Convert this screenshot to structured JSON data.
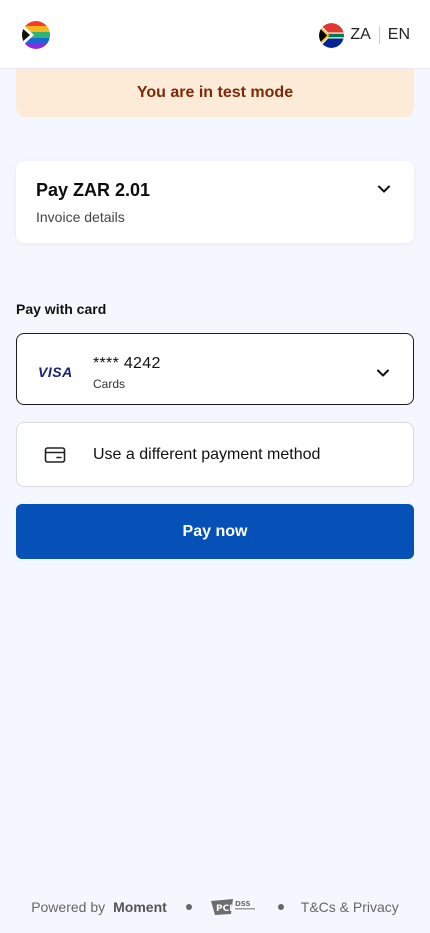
{
  "header": {
    "country_code": "ZA",
    "language_code": "EN"
  },
  "banner": {
    "text": "You are in test mode"
  },
  "summary": {
    "amount_label": "Pay ZAR 2.01",
    "details_label": "Invoice details"
  },
  "payment": {
    "section_label": "Pay with card",
    "card": {
      "brand": "VISA",
      "number": "**** 4242",
      "type": "Cards"
    },
    "alternate_label": "Use a different payment method",
    "pay_button_label": "Pay now"
  },
  "footer": {
    "powered_by": "Powered by",
    "brand": "Moment",
    "terms_link": "T&Cs & Privacy",
    "pci_label": "PCI DSS"
  },
  "colors": {
    "primary": "#0651b8",
    "background": "#f4f7fd",
    "banner_bg": "#fcebd7",
    "banner_text": "#7d2a0c"
  },
  "icons": {
    "logo": "merchant-logo-icon",
    "flag": "south-africa-flag-icon",
    "expand": "chevron-down-icon",
    "card": "credit-card-icon",
    "compliance": "pci-dss-icon"
  }
}
